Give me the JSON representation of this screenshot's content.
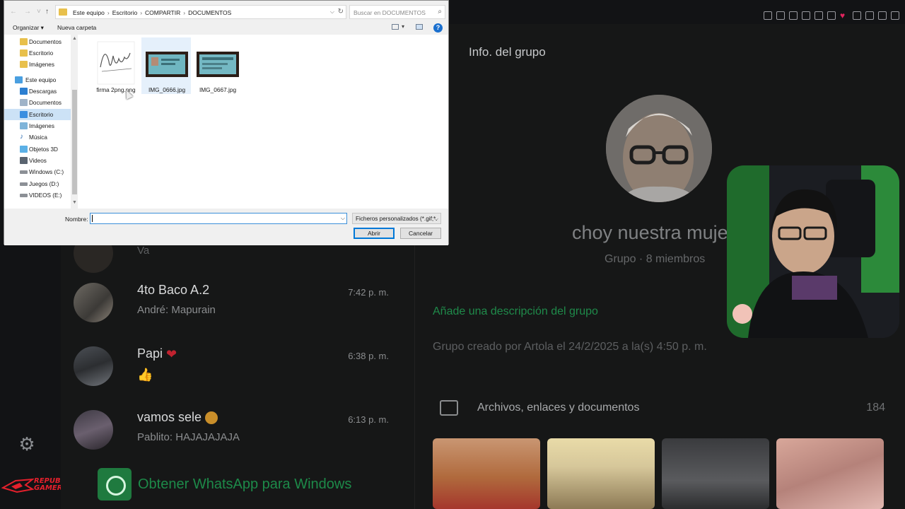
{
  "whatsapp": {
    "chats": [
      {
        "name": "",
        "time": "",
        "message": "Va"
      },
      {
        "name": "4to Baco A.2",
        "time": "7:42 p. m.",
        "message": "André: Mapurain"
      },
      {
        "name": "Papi",
        "time": "6:38 p. m.",
        "message": ""
      },
      {
        "name": "vamos sele",
        "time": "6:13 p. m.",
        "message": "Pablito: HAJAJAJAJA"
      }
    ],
    "get_app": "Obtener WhatsApp para Windows",
    "info": {
      "title": "Info. del grupo",
      "group_name": "choy nuestra muje",
      "subtitle": "Grupo · 8 miembros",
      "add_description": "Añade una descripción del grupo",
      "created": "Grupo creado por Artola el 24/2/2025 a la(s) 4:50 p. m.",
      "files_label": "Archivos, enlaces y documentos",
      "files_count": "184"
    },
    "colors": {
      "accent": "#1f8a4a",
      "background": "#161717"
    }
  },
  "rog": {
    "line1": "REPUBLIC OF",
    "line2": "GAMERS"
  },
  "dialog": {
    "breadcrumbs": [
      "Este equipo",
      "Escritorio",
      "COMPARTIR",
      "DOCUMENTOS"
    ],
    "search_placeholder": "Buscar en DOCUMENTOS",
    "organize": "Organizar ▾",
    "new_folder": "Nueva carpeta",
    "help": "?",
    "nav_items": [
      {
        "label": "Documentos",
        "icon": "folder-icon"
      },
      {
        "label": "Escritorio",
        "icon": "folder-icon"
      },
      {
        "label": "Imágenes",
        "icon": "folder-icon"
      },
      {
        "label": "Este equipo",
        "icon": "computer-icon"
      },
      {
        "label": "Descargas",
        "icon": "download-icon"
      },
      {
        "label": "Documentos",
        "icon": "documents-icon"
      },
      {
        "label": "Escritorio",
        "icon": "desktop-icon",
        "selected": true
      },
      {
        "label": "Imágenes",
        "icon": "pictures-icon"
      },
      {
        "label": "Música",
        "icon": "music-icon"
      },
      {
        "label": "Objetos 3D",
        "icon": "objects3d-icon"
      },
      {
        "label": "Videos",
        "icon": "videos-icon"
      },
      {
        "label": "Windows (C:)",
        "icon": "drive-icon"
      },
      {
        "label": "Juegos  (D:)",
        "icon": "drive-icon"
      },
      {
        "label": "VIDEOS (E:)",
        "icon": "drive-icon"
      }
    ],
    "files": [
      {
        "name": "firma 2png.png"
      },
      {
        "name": "IMG_0666.jpg"
      },
      {
        "name": "IMG_0667.jpg"
      }
    ],
    "name_label": "Nombre:",
    "name_value": "",
    "filter": "Ficheros personalizados (*.gif;*.",
    "open": "Abrir",
    "cancel": "Cancelar"
  }
}
